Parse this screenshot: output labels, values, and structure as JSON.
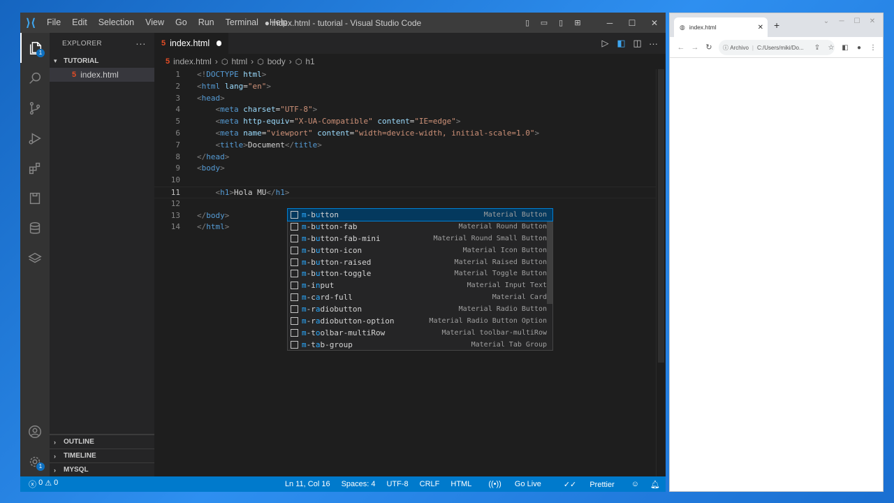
{
  "vscode": {
    "menu": [
      "File",
      "Edit",
      "Selection",
      "View",
      "Go",
      "Run",
      "Terminal",
      "Help"
    ],
    "window_title": "● index.html - tutorial - Visual Studio Code",
    "sidebar": {
      "header": "EXPLORER",
      "folder": "TUTORIAL",
      "file": "index.html",
      "outline": "OUTLINE",
      "timeline": "TIMELINE",
      "mysql": "MYSQL"
    },
    "explorer_badge": "1",
    "settings_badge": "1",
    "tab": {
      "label": "index.html"
    },
    "breadcrumb": [
      "index.html",
      "html",
      "body",
      "h1"
    ],
    "code_lines": [
      {
        "n": "1",
        "html": "<span class='p'>&lt;!</span><span class='t'>DOCTYPE</span> <span class='a'>html</span><span class='p'>&gt;</span>"
      },
      {
        "n": "2",
        "html": "<span class='p'>&lt;</span><span class='t'>html</span> <span class='a'>lang</span><span class='w'>=</span><span class='s'>\"en\"</span><span class='p'>&gt;</span>"
      },
      {
        "n": "3",
        "html": "<span class='p'>&lt;</span><span class='t'>head</span><span class='p'>&gt;</span>"
      },
      {
        "n": "4",
        "html": "    <span class='p'>&lt;</span><span class='t'>meta</span> <span class='a'>charset</span><span class='w'>=</span><span class='s'>\"UTF-8\"</span><span class='p'>&gt;</span>"
      },
      {
        "n": "5",
        "html": "    <span class='p'>&lt;</span><span class='t'>meta</span> <span class='a'>http-equiv</span><span class='w'>=</span><span class='s'>\"X-UA-Compatible\"</span> <span class='a'>content</span><span class='w'>=</span><span class='s'>\"IE=edge\"</span><span class='p'>&gt;</span>"
      },
      {
        "n": "6",
        "html": "    <span class='p'>&lt;</span><span class='t'>meta</span> <span class='a'>name</span><span class='w'>=</span><span class='s'>\"viewport\"</span> <span class='a'>content</span><span class='w'>=</span><span class='s'>\"width=device-width, initial-scale=1.0\"</span><span class='p'>&gt;</span>"
      },
      {
        "n": "7",
        "html": "    <span class='p'>&lt;</span><span class='t'>title</span><span class='p'>&gt;</span><span class='w'>Document</span><span class='p'>&lt;/</span><span class='t'>title</span><span class='p'>&gt;</span>"
      },
      {
        "n": "8",
        "html": "<span class='p'>&lt;/</span><span class='t'>head</span><span class='p'>&gt;</span>"
      },
      {
        "n": "9",
        "html": "<span class='p'>&lt;</span><span class='t'>body</span><span class='p'>&gt;</span>"
      },
      {
        "n": "10",
        "html": ""
      },
      {
        "n": "11",
        "html": "    <span class='p'>&lt;</span><span class='t'>h1</span><span class='p'>&gt;</span><span class='w'>Hola MU</span><span class='p'>&lt;/</span><span class='t'>h1</span><span class='p'>&gt;</span>"
      },
      {
        "n": "12",
        "html": ""
      },
      {
        "n": "13",
        "html": "<span class='p'>&lt;/</span><span class='t'>body</span><span class='p'>&gt;</span>"
      },
      {
        "n": "14",
        "html": "<span class='p'>&lt;/</span><span class='t'>html</span><span class='p'>&gt;</span>"
      }
    ],
    "current_line": "11",
    "suggestions": [
      {
        "label": "m-button",
        "detail": "Material Button"
      },
      {
        "label": "m-button-fab",
        "detail": "Material Round Button"
      },
      {
        "label": "m-button-fab-mini",
        "detail": "Material Round Small Button"
      },
      {
        "label": "m-button-icon",
        "detail": "Material Icon Button"
      },
      {
        "label": "m-button-raised",
        "detail": "Material Raised Button"
      },
      {
        "label": "m-button-toggle",
        "detail": "Material Toggle Button"
      },
      {
        "label": "m-input",
        "detail": "Material Input Text"
      },
      {
        "label": "m-card-full",
        "detail": "Material Card"
      },
      {
        "label": "m-radiobutton",
        "detail": "Material Radio Button"
      },
      {
        "label": "m-radiobutton-option",
        "detail": "Material Radio Button Option"
      },
      {
        "label": "m-toolbar-multiRow",
        "detail": "Material toolbar-multiRow"
      },
      {
        "label": "m-tab-group",
        "detail": "Material Tab Group"
      }
    ],
    "status": {
      "errors": "0",
      "warnings": "0",
      "position": "Ln 11, Col 16",
      "spaces": "Spaces: 4",
      "encoding": "UTF-8",
      "eol": "CRLF",
      "language": "HTML",
      "golive": "Go Live",
      "prettier": "Prettier"
    }
  },
  "chrome": {
    "tab_title": "index.html",
    "url_prefix": "Archivo",
    "url": "C:/Users/miki/Do..."
  },
  "colors": {
    "accent": "#007acc",
    "titlebar": "#3c3c3c",
    "editor_bg": "#1e1e1e"
  }
}
